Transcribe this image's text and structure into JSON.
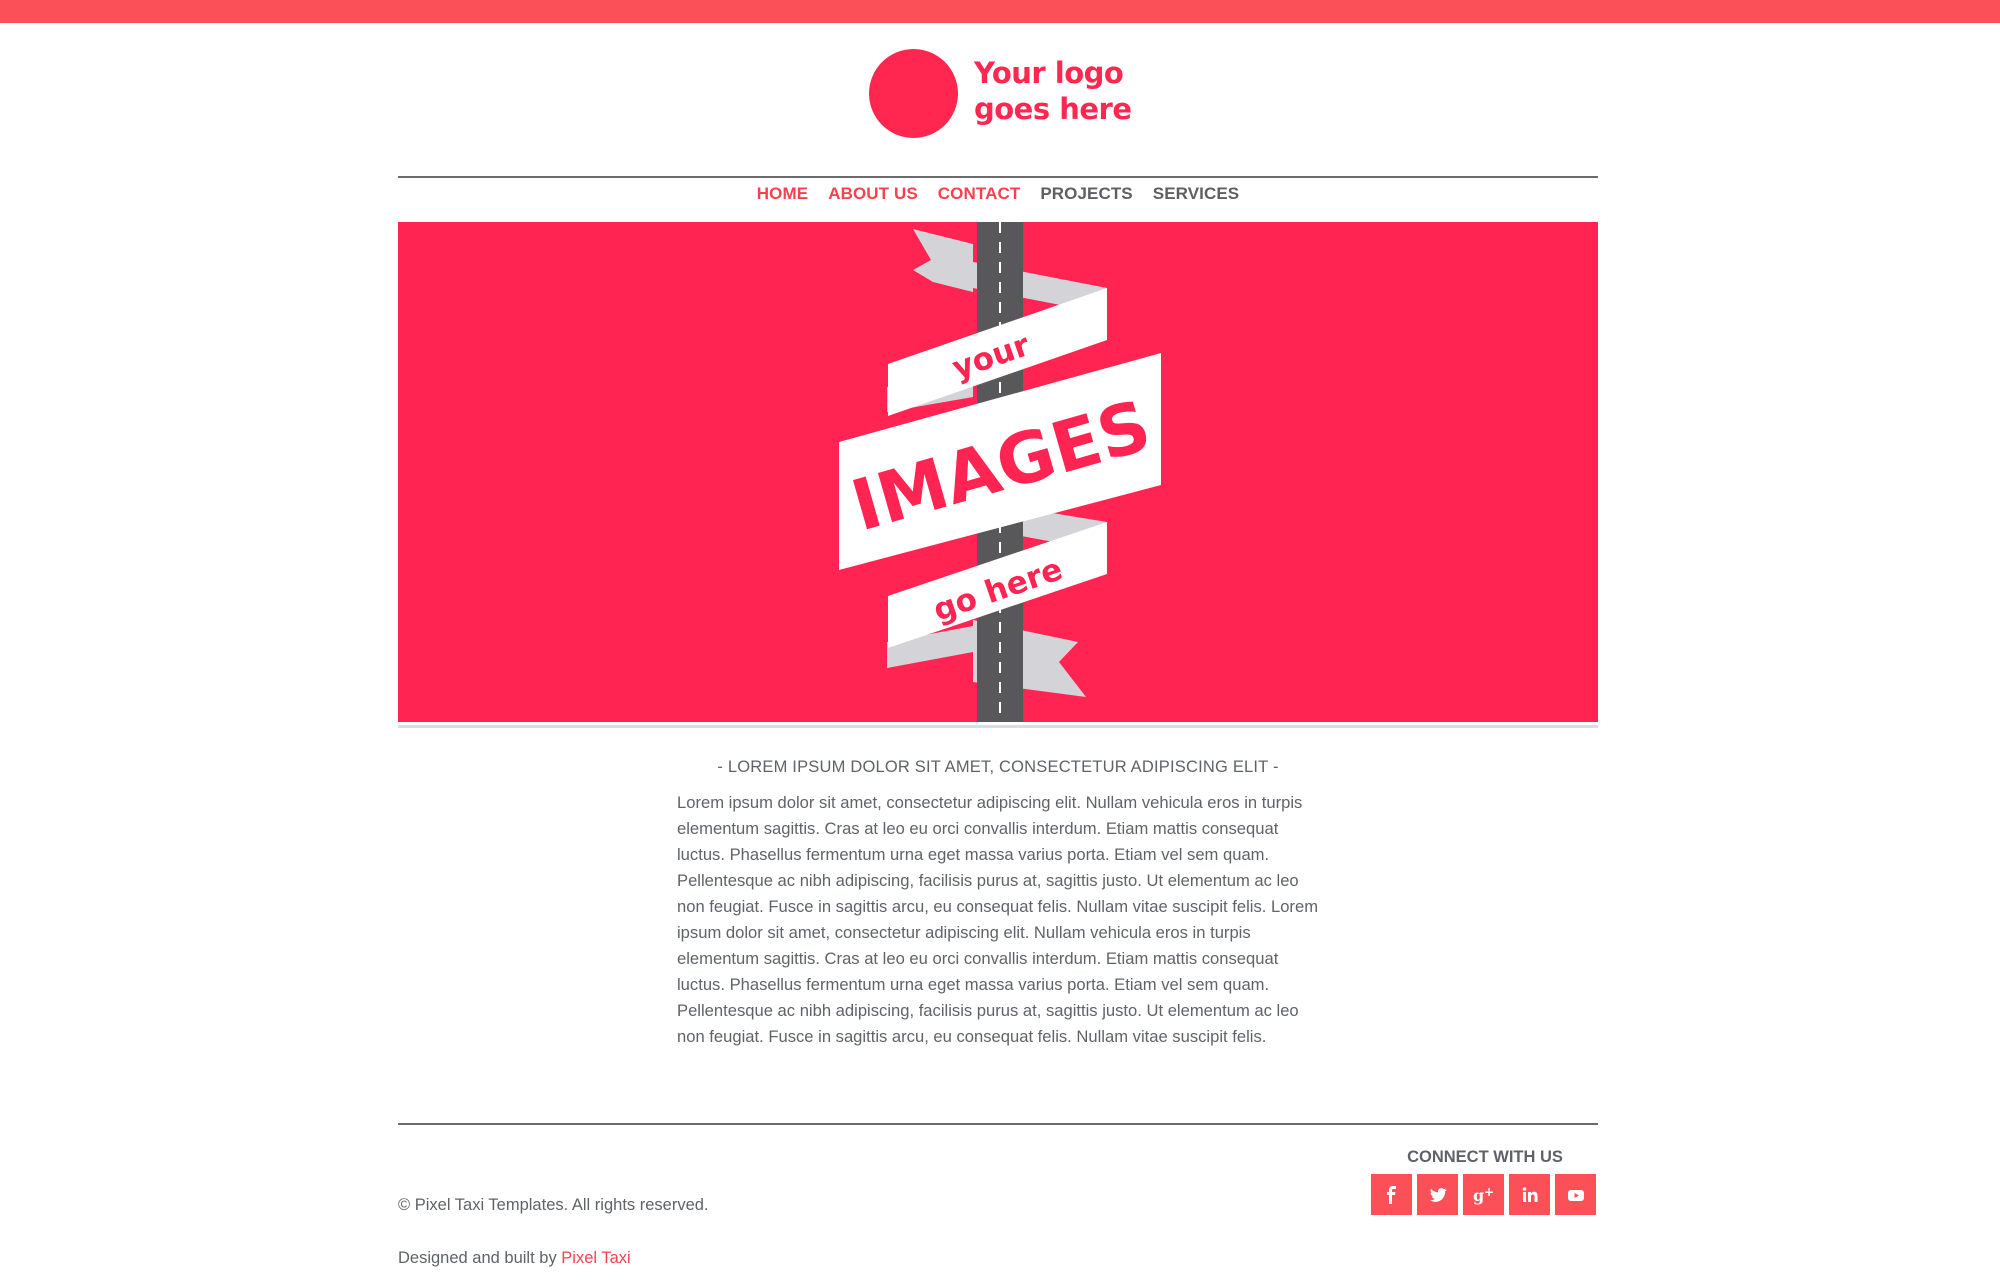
{
  "logo": {
    "line1": "Your logo",
    "line2": "goes here",
    "color": "#ff2650"
  },
  "nav": {
    "items": [
      {
        "label": "HOME",
        "active": true
      },
      {
        "label": "ABOUT US",
        "active": true
      },
      {
        "label": "CONTACT",
        "active": true
      },
      {
        "label": "PROJECTS",
        "active": false
      },
      {
        "label": "SERVICES",
        "active": false
      }
    ],
    "active_color": "#f9404f"
  },
  "hero": {
    "background": "#ff2451",
    "ribbon_top": "your",
    "ribbon_middle": "IMAGES",
    "ribbon_bottom": "go here"
  },
  "content": {
    "title": "- LOREM IPSUM DOLOR SIT AMET, CONSECTETUR ADIPISCING ELIT -",
    "body": "Lorem ipsum dolor sit amet, consectetur adipiscing elit. Nullam vehicula eros in turpis elementum sagittis. Cras at leo eu orci convallis interdum. Etiam mattis consequat luctus. Phasellus fermentum urna eget massa varius porta. Etiam vel sem quam. Pellentesque ac nibh adipiscing, facilisis purus at, sagittis justo. Ut elementum ac leo non feugiat. Fusce in sagittis arcu, eu consequat felis. Nullam vitae suscipit felis. Lorem ipsum dolor sit amet, consectetur adipiscing elit. Nullam vehicula eros in turpis elementum sagittis. Cras at leo eu orci convallis interdum. Etiam mattis consequat luctus. Phasellus fermentum urna eget massa varius porta. Etiam vel sem quam. Pellentesque ac nibh adipiscing, facilisis purus at, sagittis justo. Ut elementum ac leo non feugiat. Fusce in sagittis arcu, eu consequat felis. Nullam vitae suscipit felis."
  },
  "footer": {
    "copyright": "© Pixel Taxi Templates. All rights reserved.",
    "credit_prefix": "Designed and built by",
    "credit_link": "Pixel Taxi",
    "connect_title": "CONNECT WITH US",
    "social": [
      {
        "icon": "facebook-icon"
      },
      {
        "icon": "twitter-icon"
      },
      {
        "icon": "google-plus-icon"
      },
      {
        "icon": "linkedin-icon"
      },
      {
        "icon": "youtube-icon"
      }
    ],
    "social_color": "#fb5057"
  }
}
